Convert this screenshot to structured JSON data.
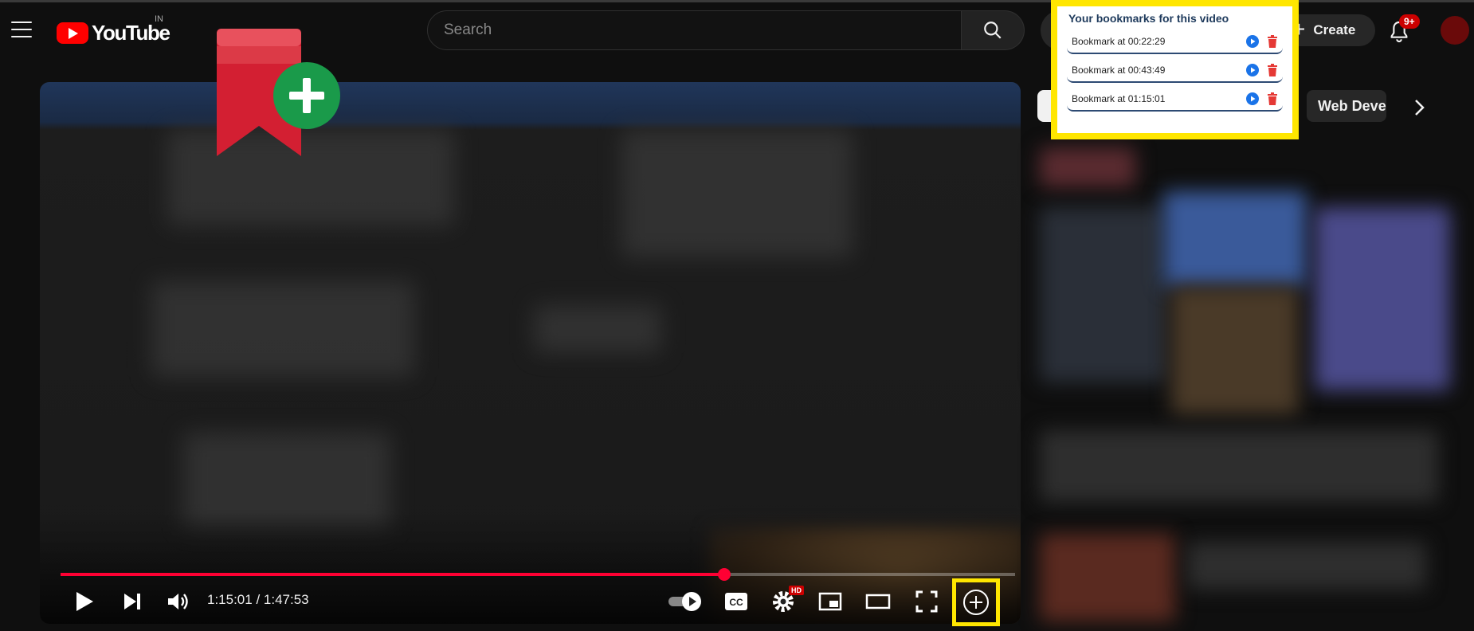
{
  "header": {
    "logo_text": "YouTube",
    "country_code": "IN",
    "search_placeholder": "Search",
    "create_label": "Create",
    "notifications_count": "9+"
  },
  "player": {
    "time_current": "1:15:01",
    "time_total": "1:47:53",
    "time_display": "1:15:01 / 1:47:53",
    "progress_fraction": 0.6953,
    "hd_badge": "HD"
  },
  "chips": {
    "partial_chip_label": "Web Devel"
  },
  "bookmarks_popup": {
    "title": "Your bookmarks for this video",
    "items": [
      {
        "label": "Bookmark at 00:22:29"
      },
      {
        "label": "Bookmark at 00:43:49"
      },
      {
        "label": "Bookmark at 01:15:01"
      }
    ]
  },
  "colors": {
    "youtube_red": "#ff0000",
    "progress_red": "#ff0033",
    "highlight_yellow": "#ffe600",
    "play_blue": "#1a73e8",
    "delete_red": "#e53935",
    "ext_green": "#1a9a4a"
  },
  "icons": [
    "menu-icon",
    "youtube-logo-icon",
    "search-icon",
    "plus-icon",
    "bell-icon",
    "play-icon",
    "next-icon",
    "volume-icon",
    "autoplay-toggle-icon",
    "captions-icon",
    "settings-icon",
    "miniplayer-icon",
    "theater-icon",
    "fullscreen-icon",
    "add-bookmark-icon",
    "bookmark-extension-icon",
    "chevron-right-icon"
  ]
}
